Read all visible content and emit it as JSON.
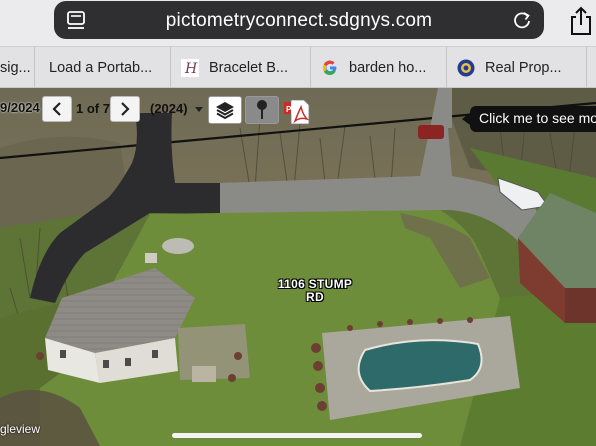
{
  "browser": {
    "url": "pictometryconnect.sdgnys.com",
    "icons": {
      "reader": "reader-mode-icon",
      "reload": "reload-icon",
      "share": "share-icon"
    },
    "tabs": [
      {
        "label": "sig...",
        "favicon": ""
      },
      {
        "label": "Load a Portab...",
        "favicon": ""
      },
      {
        "label": "Bracelet B...",
        "favicon": "H-script-logo"
      },
      {
        "label": "barden ho...",
        "favicon": "google-logo"
      },
      {
        "label": "Real Prop...",
        "favicon": "state-seal-logo"
      }
    ]
  },
  "viewer": {
    "date_partial": "9/2024",
    "page_count": "1 of 7",
    "year_select": "(2024)",
    "tooltip": "Click me to see mo",
    "address_line1": "1106 STUMP",
    "address_line2": "RD",
    "view_label": "gleview",
    "icons": {
      "prev": "chevron-left-icon",
      "next": "chevron-right-icon",
      "layers": "layers-icon",
      "pin": "map-pin-icon",
      "pdf": "pdf-icon"
    },
    "colors": {
      "grass": "#6d8d3a",
      "driveway": "#2c2c2e",
      "gravel": "#8a8a86",
      "pool_water": "#2f6a6a",
      "toolbar_pin_button": "#8a8a8a",
      "layers_button": "#ffffff"
    }
  }
}
